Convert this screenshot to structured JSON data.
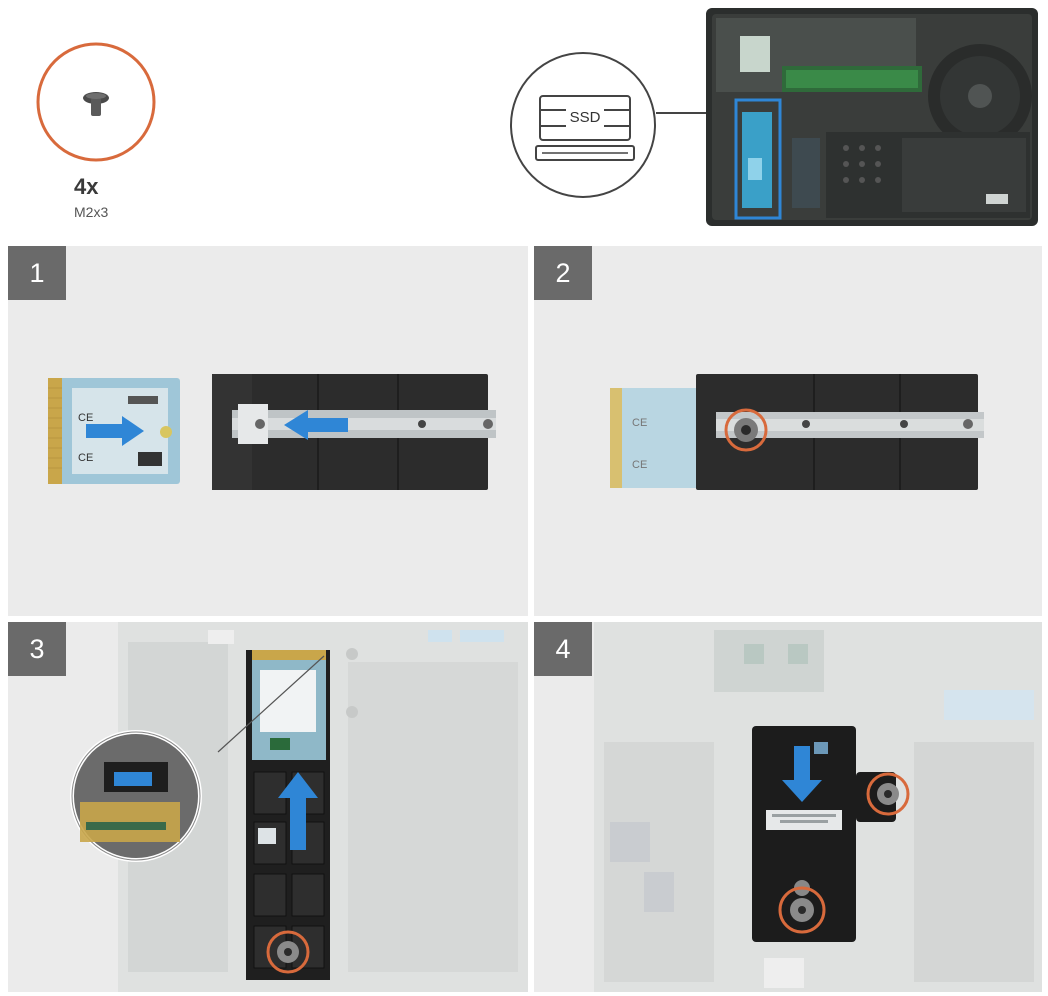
{
  "screw": {
    "quantity": "4x",
    "size": "M2x3",
    "icon": "screw-icon"
  },
  "legend": {
    "ssd_label": "SSD"
  },
  "steps": [
    {
      "number": "1"
    },
    {
      "number": "2"
    },
    {
      "number": "3"
    },
    {
      "number": "4"
    }
  ],
  "colors": {
    "accent_blue": "#2f86d6",
    "highlight_orange": "#d86a3c",
    "panel_bg": "#ebebeb",
    "badge_bg": "#6a6a6a",
    "ssd_board": "#9fc6d8",
    "heatsink": "#2c2c2c"
  }
}
